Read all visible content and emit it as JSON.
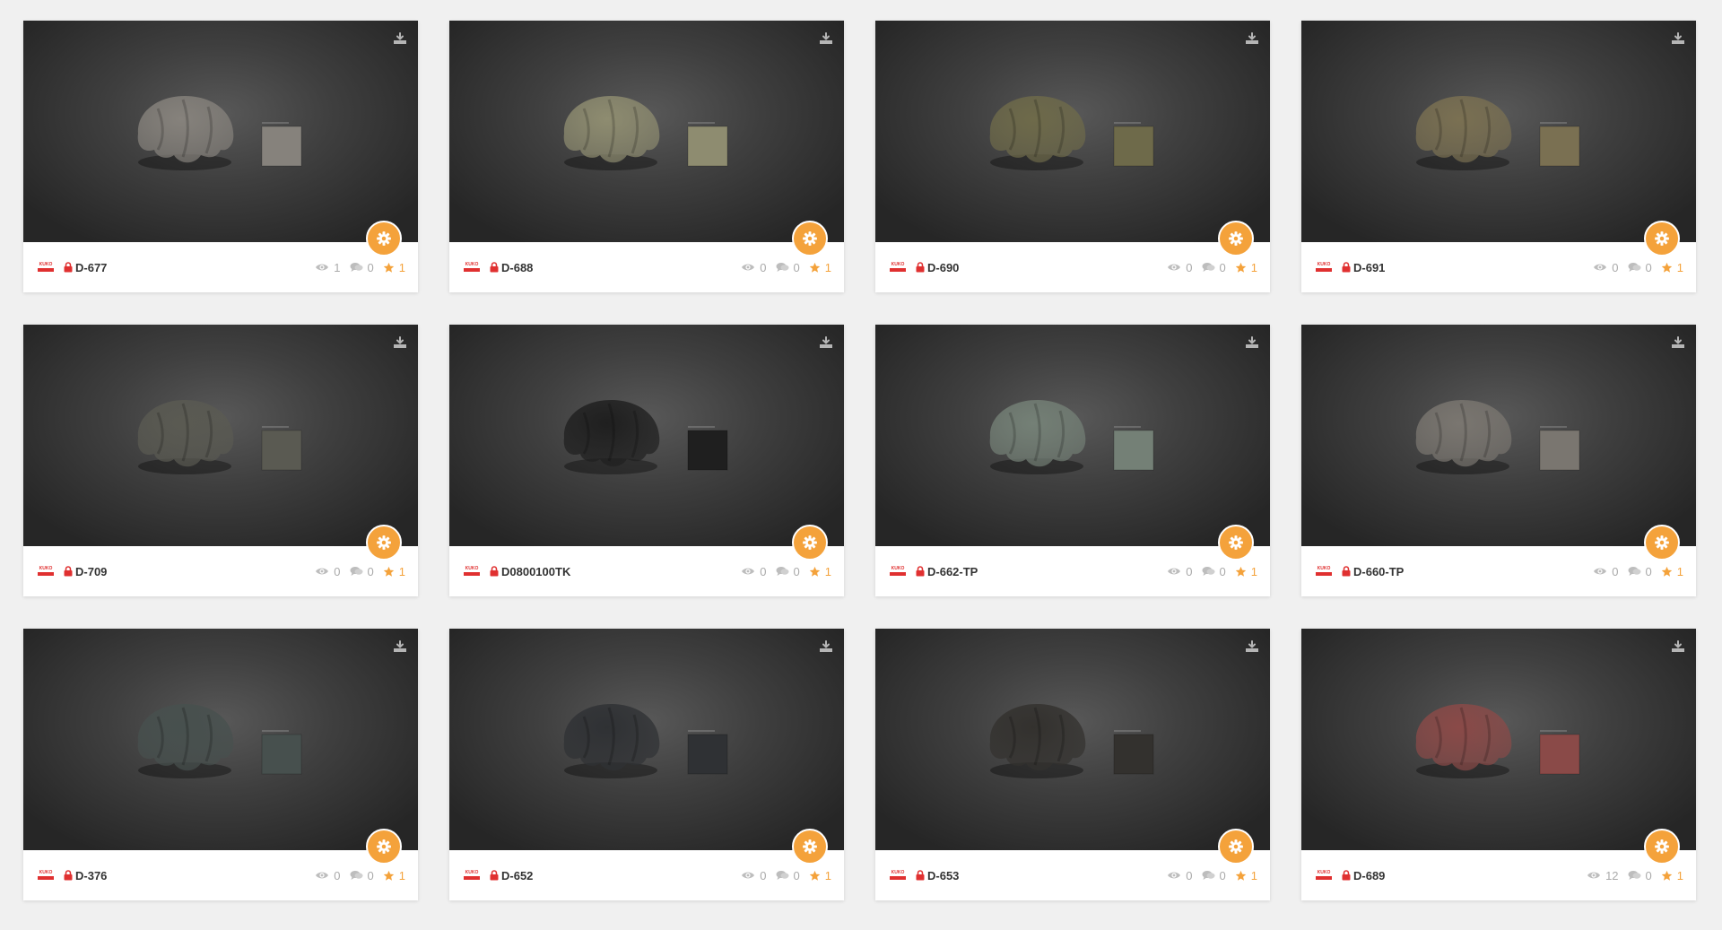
{
  "brand": {
    "logo_text": "KUKO"
  },
  "colors": {
    "accent": "#f4a23b",
    "lock": "#e03030",
    "stat": "#aaaaaa"
  },
  "icons": {
    "download": "download-icon",
    "settings": "gear-icon",
    "lock": "lock-icon",
    "views": "eye-icon",
    "comments": "comment-icon",
    "favorites": "star-icon"
  },
  "items": [
    {
      "title": "D-677",
      "views": "1",
      "comments": "0",
      "stars": "1",
      "color": "#86827c"
    },
    {
      "title": "D-688",
      "views": "0",
      "comments": "0",
      "stars": "1",
      "color": "#8e8c70"
    },
    {
      "title": "D-690",
      "views": "0",
      "comments": "0",
      "stars": "1",
      "color": "#6e6a4a"
    },
    {
      "title": "D-691",
      "views": "0",
      "comments": "0",
      "stars": "1",
      "color": "#7a7052"
    },
    {
      "title": "D-709",
      "views": "0",
      "comments": "0",
      "stars": "1",
      "color": "#5a5a52"
    },
    {
      "title": "D0800100TK",
      "views": "0",
      "comments": "0",
      "stars": "1",
      "color": "#1f1f1f"
    },
    {
      "title": "D-662-TP",
      "views": "0",
      "comments": "0",
      "stars": "1",
      "color": "#748076"
    },
    {
      "title": "D-660-TP",
      "views": "0",
      "comments": "0",
      "stars": "1",
      "color": "#7a7670"
    },
    {
      "title": "D-376",
      "views": "0",
      "comments": "0",
      "stars": "1",
      "color": "#47504e"
    },
    {
      "title": "D-652",
      "views": "0",
      "comments": "0",
      "stars": "1",
      "color": "#2f3134"
    },
    {
      "title": "D-653",
      "views": "0",
      "comments": "0",
      "stars": "1",
      "color": "#33312e"
    },
    {
      "title": "D-689",
      "views": "12",
      "comments": "0",
      "stars": "1",
      "color": "#8a4a48"
    }
  ]
}
